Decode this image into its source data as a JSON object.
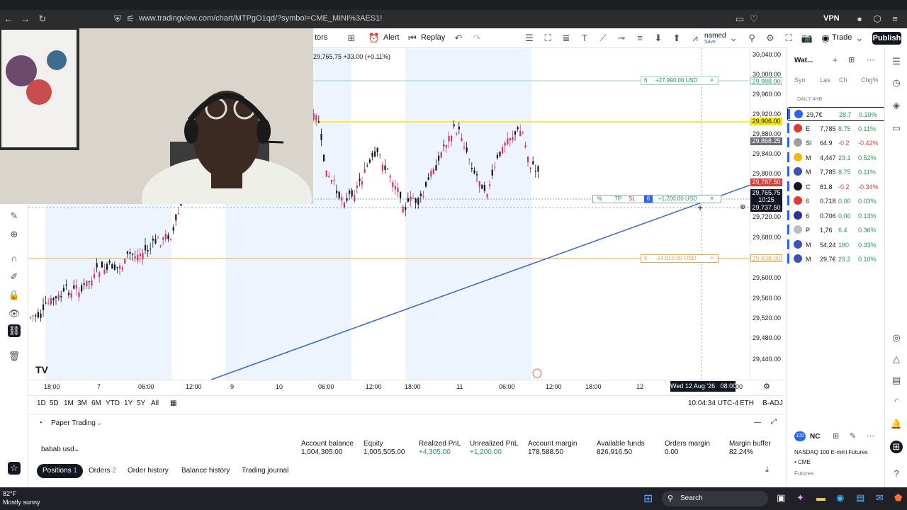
{
  "browser": {
    "url": "www.tradingview.com/chart/MTPgO1qd/?symbol=CME_MINI%3AES1!",
    "vpn_label": "VPN"
  },
  "toolbar": {
    "indicators_label": "tors",
    "alert_label": "Alert",
    "replay_label": "Replay",
    "layout_name": "named",
    "layout_sub": "Save",
    "trade_label": "Trade",
    "publish_label": "Publish"
  },
  "legend": {
    "ohlc_text": "29,765.75 +33.00 (+0.11%)"
  },
  "price_axis": {
    "labels": [
      "30,040.00",
      "30,000.00",
      "29,960.00",
      "29,920.00",
      "29,880.00",
      "29,840.00",
      "29,800.00",
      "29,760.00",
      "29,720.00",
      "29,680.00",
      "29,600.00",
      "29,560.00",
      "29,520.00",
      "29,480.00",
      "29,440.00"
    ],
    "tags": {
      "tp": "29,988.00",
      "yellow": "29,906.00",
      "gray": "29,868.25",
      "red": "29,787.50",
      "last": "29,765.75",
      "countdown": "10:25",
      "cross": "29,737.50",
      "sl": "29,638.00"
    }
  },
  "orders": {
    "tp": {
      "qty": "6",
      "text": "+27,990.00 USD",
      "close": "×"
    },
    "position": {
      "pct": "%",
      "tp": "TP",
      "sl": "SL",
      "qty": "6",
      "text": "+1,200.00 USD",
      "close": "×"
    },
    "sl": {
      "qty": "6",
      "text": "-14,010.00 USD",
      "close": "×"
    }
  },
  "time_axis": {
    "labels": [
      "18:00",
      "7",
      "06:00",
      "12:00",
      "9",
      "10",
      "06:00",
      "12:00",
      "18:00",
      "11",
      "06:00",
      "12:00",
      "18:00",
      "12"
    ],
    "cursor_label": "Wed 12 Aug '26   08:00",
    "cursor_tail": "00"
  },
  "ranges": {
    "buttons": [
      "1D",
      "5D",
      "1M",
      "3M",
      "6M",
      "YTD",
      "1Y",
      "5Y",
      "All"
    ],
    "clock": "10:04:34 UTC-4",
    "session": "ETH",
    "adj": "B-ADJ"
  },
  "panel": {
    "broker": "Paper Trading",
    "account": "babab usd",
    "metrics": [
      {
        "label": "Account balance",
        "value": "1,004,305.00"
      },
      {
        "label": "Equity",
        "value": "1,005,505.00"
      },
      {
        "label": "Realized PnL",
        "value": "+4,305.00"
      },
      {
        "label": "Unrealized PnL",
        "value": "+1,200.00"
      },
      {
        "label": "Account margin",
        "value": "178,588.50"
      },
      {
        "label": "Available funds",
        "value": "826,916.50"
      },
      {
        "label": "Orders margin",
        "value": "0.00"
      },
      {
        "label": "Margin buffer",
        "value": "82.24%"
      }
    ],
    "tabs": {
      "positions": "Positions",
      "positions_count": "1",
      "orders": "Orders",
      "orders_count": "2",
      "order_history": "Order history",
      "balance_history": "Balance history",
      "journal": "Trading journal"
    }
  },
  "watchlist": {
    "title": "Wat...",
    "cols": [
      "Syn",
      "Las",
      "Ch",
      "Chg%"
    ],
    "section": "DAILY 4HR",
    "rows": [
      {
        "sym": "29,7€",
        "last": "28.7",
        "chg": "0.10%",
        "color": "#1e9e5a",
        "badge": "#2962ff"
      },
      {
        "sym": "E",
        "last": "7,785",
        "chg": "8.75",
        "pct": "0.11%",
        "color": "#1e9e5a",
        "badge": "#e53935"
      },
      {
        "sym": "SI",
        "last": "64.9",
        "chg": "-0.2",
        "pct": "-0.42%",
        "color": "#e53935",
        "badge": "#9e9e9e"
      },
      {
        "sym": "M",
        "last": "4,447",
        "chg": "23.1",
        "pct": "0.52%",
        "color": "#1e9e5a",
        "badge": "#f0b90b"
      },
      {
        "sym": "M",
        "last": "7,785",
        "chg": "8.75",
        "pct": "0.11%",
        "color": "#1e9e5a",
        "badge": "#3f51b5"
      },
      {
        "sym": "C",
        "last": "81.8",
        "chg": "-0.2",
        "pct": "-0.34%",
        "color": "#e53935",
        "badge": "#131722"
      },
      {
        "sym": "6",
        "last": "0.718",
        "chg": "0.00",
        "pct": "0.03%",
        "color": "#1e9e5a",
        "badge": "#e53935"
      },
      {
        "sym": "6",
        "last": "0.706",
        "chg": "0.00",
        "pct": "0.13%",
        "color": "#1e9e5a",
        "badge": "#283593"
      },
      {
        "sym": "P",
        "last": "1,76",
        "chg": "6.4",
        "pct": "0.36%",
        "color": "#1e9e5a",
        "badge": "#bdbdbd"
      },
      {
        "sym": "M",
        "last": "54,24",
        "chg": "180",
        "pct": "0.33%",
        "color": "#1e9e5a",
        "badge": "#3f51b5"
      },
      {
        "sym": "M",
        "last": "29,7€",
        "chg": "29.2",
        "pct": "0.10%",
        "color": "#1e9e5a",
        "badge": "#3f51b5"
      }
    ],
    "details": {
      "symbol": "NC",
      "name": "NASDAQ 100 E-mini Futures",
      "exchange": "• CME",
      "type": "Futures"
    }
  },
  "taskbar": {
    "weather_temp": "82°F",
    "weather_text": "Mostly sunny",
    "search_label": "Search"
  }
}
